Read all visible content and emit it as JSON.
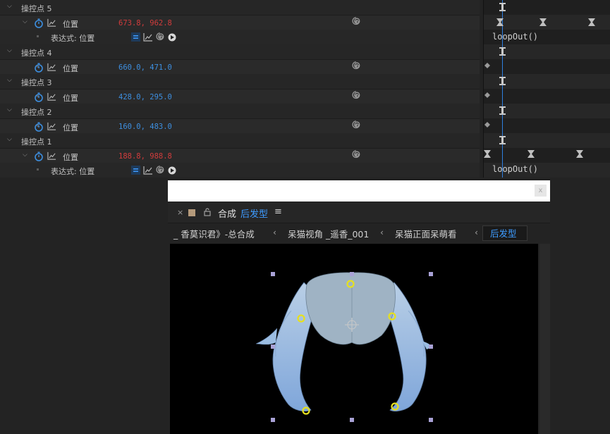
{
  "timeline": {
    "groups": [
      {
        "name": "操控点 5",
        "property": "位置",
        "value": "673.8, 962.8",
        "value_color": "#d23c3c",
        "expression": true
      },
      {
        "name": "操控点 4",
        "property": "位置",
        "value": "660.0, 471.0",
        "value_color": "#3d8fe0",
        "expression": false
      },
      {
        "name": "操控点 3",
        "property": "位置",
        "value": "428.0, 295.0",
        "value_color": "#3d8fe0",
        "expression": false
      },
      {
        "name": "操控点 2",
        "property": "位置",
        "value": "160.0, 483.0",
        "value_color": "#3d8fe0",
        "expression": false
      },
      {
        "name": "操控点 1",
        "property": "位置",
        "value": "188.8, 988.8",
        "value_color": "#d23c3c",
        "expression": true
      }
    ],
    "expression_label": "表达式: 位置",
    "expression_code": "loopOut()"
  },
  "comp_panel": {
    "close_glyph": "×",
    "label": "合成",
    "comp_name": "后发型",
    "menu_glyph": "≡",
    "breadcrumbs": [
      "_ 香莫识君》-总合成",
      "呆猫视角 _遥香_001",
      "呆猫正面呆萌看",
      "后发型"
    ],
    "separator": "‹"
  },
  "colors": {
    "accent_blue": "#3d9bff",
    "keyframe_red": "#d23c3c",
    "hair_blue": "#a9c6e6",
    "handle_yellow": "#e6e01f"
  }
}
